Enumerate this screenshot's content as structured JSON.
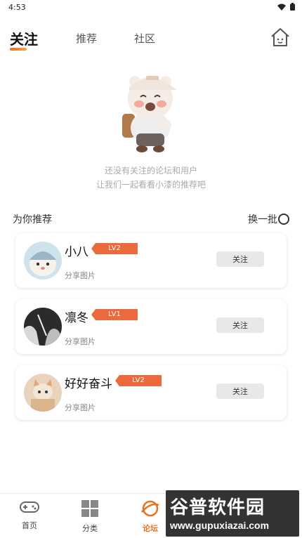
{
  "status_bar": {
    "time": "4:53",
    "wifi_icon": "wifi-icon",
    "battery_icon": "battery-icon"
  },
  "tabs": [
    {
      "label": "关注",
      "active": true
    },
    {
      "label": "推荐",
      "active": false
    },
    {
      "label": "社区",
      "active": false
    }
  ],
  "home_icon": "home-icon",
  "empty_state": {
    "line1": "还没有关注的论坛和用户",
    "line2": "让我们一起看看小漆的推荐吧",
    "mascot": "bear-mascot-illustration"
  },
  "recommend": {
    "title": "为你推荐",
    "refresh_label": "换一批"
  },
  "users": [
    {
      "name": "小八",
      "level": "LV2",
      "subtitle": "分享图片",
      "follow_label": "关注"
    },
    {
      "name": "凛冬",
      "level": "LV1",
      "subtitle": "分享图片",
      "follow_label": "关注"
    },
    {
      "name": "好好奋斗",
      "level": "LV2",
      "subtitle": "分享图片",
      "follow_label": "关注"
    }
  ],
  "bottom_nav": [
    {
      "label": "首页",
      "icon": "gamepad-icon",
      "active": false
    },
    {
      "label": "分类",
      "icon": "grid-icon",
      "active": false
    },
    {
      "label": "论坛",
      "icon": "planet-icon",
      "active": true
    }
  ],
  "watermark": {
    "main": "谷普软件园",
    "sub": "www.gupuxiazai.com"
  },
  "colors": {
    "accent": "#e8731f",
    "badge": "#ea6a3d",
    "follow_bg": "#e8e8e8"
  }
}
